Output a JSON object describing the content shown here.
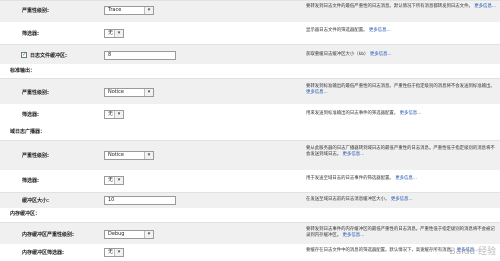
{
  "rows": [
    {
      "label": "严重性级别:",
      "select": "Trace",
      "desc": "要转发到日志文件的最低严重性的日志消息。默认情况下所有消息都转发到日志文件。",
      "more": "更多信息..."
    },
    {
      "label": "筛选器:",
      "select": "无",
      "desc": "显示器日志文件的筛选器配置。",
      "more": "更多信息..."
    },
    {
      "label": "日志文件缓冲区:",
      "input": "8",
      "desc": "获取重缓日志缓冲区大小（kb）",
      "more": "更多信息..."
    },
    {
      "section": "标准输出："
    },
    {
      "label": "严重性级别:",
      "select": "Notice",
      "desc": "要转发到标准输出的最低严重性的日志消息。严重性低于指定级别的消息将不会发送到标准输出。",
      "more": "更多信息..."
    },
    {
      "label": "筛选器:",
      "select": "无",
      "desc": "用来发送到标准输出的日志事件的筛选器配置。",
      "more": "更多信息..."
    },
    {
      "section": "域日志广播器："
    },
    {
      "label": "严重性级别:",
      "select": "Notice",
      "desc": "要从此服务器的日志广播器转到域日志的最低严重性的日志消息。严重性低于指定级别的消息将不会发送到域日志。",
      "more": "更多信息..."
    },
    {
      "label": "筛选器:",
      "select": "无",
      "desc": "用于发送至域日志的日志事件的筛选器配置。",
      "more": "更多信息..."
    },
    {
      "label": "缓冲区大小:",
      "input": "10",
      "desc": "在发送至域日志前的日志消息缓冲区大小。",
      "more": "更多信息..."
    },
    {
      "section": "内存缓冲区："
    },
    {
      "label": "内存缓冲区严重性级别:",
      "select": "Debug",
      "desc": "要转发到日志事件的内存缓冲区的最低严重性的日志消息。严重性低于指定级别的消息将不会被记录到内存缓冲区。",
      "more": "更多信息..."
    },
    {
      "label": "内存缓冲区筛选器:",
      "select": "无",
      "desc": "要缓存在日志文件中的消息的筛选器配置。默认情况下，高速缓存所有消息。",
      "more": "更多信息..."
    }
  ],
  "watermark": "Baidu 经验"
}
